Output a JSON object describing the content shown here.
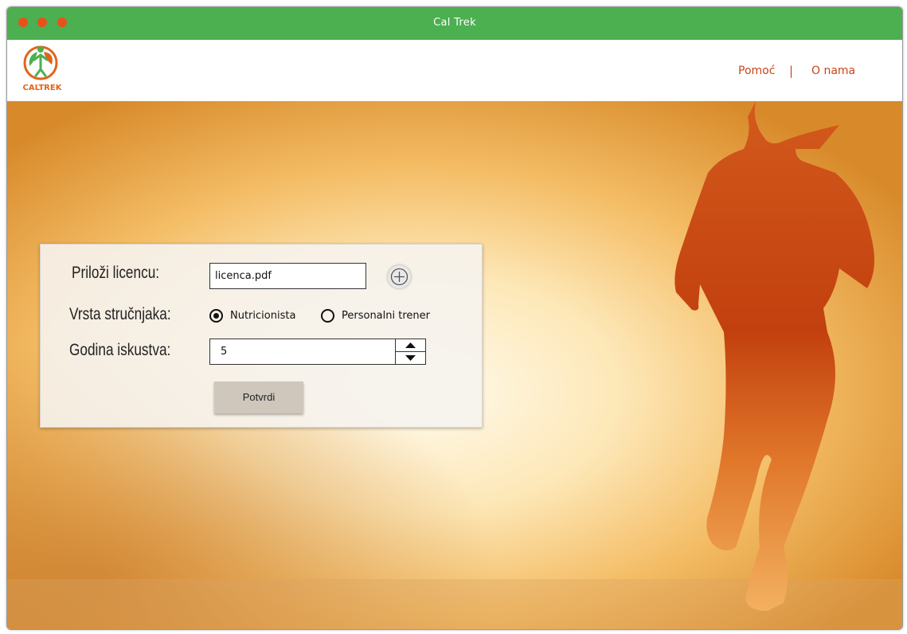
{
  "window": {
    "title": "Cal Trek"
  },
  "brand": {
    "logo_text": "CALTREK"
  },
  "nav": {
    "help": "Pomoć",
    "separator": "|",
    "about": "O nama"
  },
  "form": {
    "license_label": "Priloži licencu:",
    "license_file": "licenca.pdf",
    "type_label": "Vrsta stručnjaka:",
    "types": [
      {
        "label": "Nutricionista",
        "selected": true
      },
      {
        "label": "Personalni trener",
        "selected": false
      }
    ],
    "experience_label": "Godina iskustva:",
    "experience_value": "5",
    "submit_label": "Potvrdi"
  },
  "colors": {
    "titlebar": "#4caf50",
    "accent": "#c6471a",
    "window_dot": "#e8521a"
  },
  "icons": [
    "add-file-icon",
    "spin-up-icon",
    "spin-down-icon",
    "caltrek-logo"
  ]
}
